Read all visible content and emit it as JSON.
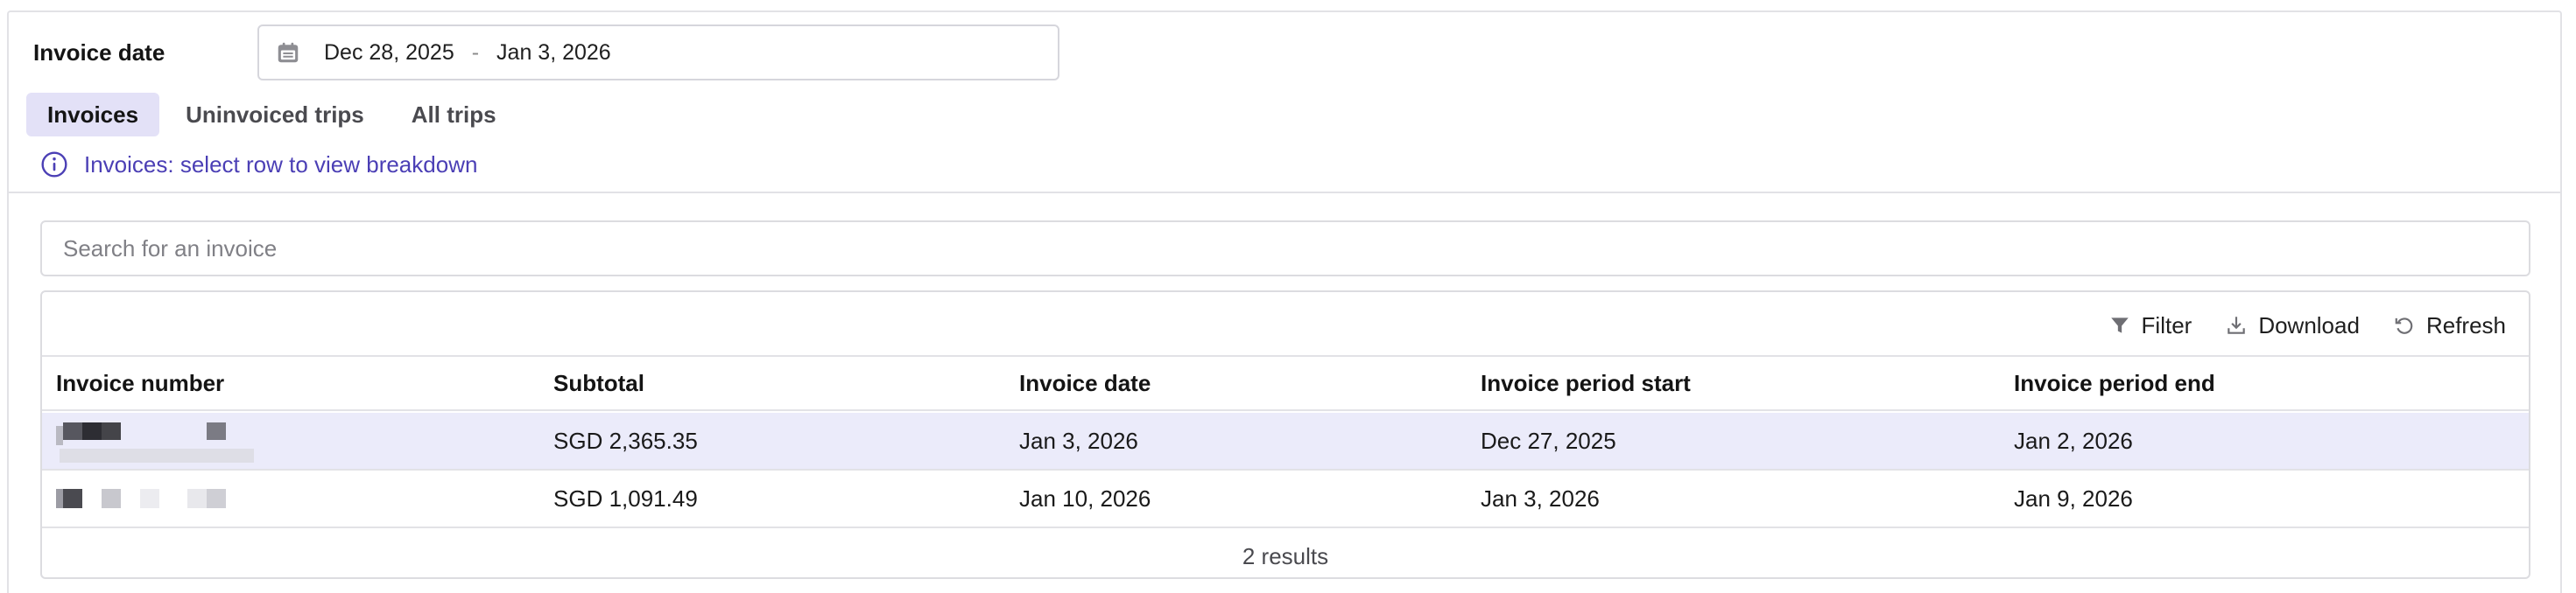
{
  "date_filter": {
    "label": "Invoice date",
    "start": "Dec 28, 2025",
    "separator": "-",
    "end": "Jan 3, 2026",
    "icon": "calendar-icon"
  },
  "tabs": [
    {
      "label": "Invoices",
      "active": true
    },
    {
      "label": "Uninvoiced trips",
      "active": false
    },
    {
      "label": "All trips",
      "active": false
    }
  ],
  "info": {
    "icon": "info-icon",
    "text": "Invoices: select row to view breakdown"
  },
  "search": {
    "placeholder": "Search for an invoice",
    "value": ""
  },
  "toolbar": {
    "filter_label": "Filter",
    "download_label": "Download",
    "refresh_label": "Refresh"
  },
  "table": {
    "columns": [
      "Invoice number",
      "Subtotal",
      "Invoice date",
      "Invoice period start",
      "Invoice period end"
    ],
    "rows": [
      {
        "invoice_number": "",
        "subtotal": "SGD 2,365.35",
        "invoice_date": "Jan 3, 2026",
        "period_start": "Dec 27, 2025",
        "period_end": "Jan 2, 2026",
        "selected": true
      },
      {
        "invoice_number": "",
        "subtotal": "SGD 1,091.49",
        "invoice_date": "Jan 10, 2026",
        "period_start": "Jan 3, 2026",
        "period_end": "Jan 9, 2026",
        "selected": false
      }
    ],
    "results_text": "2 results"
  },
  "colors": {
    "accent": "#4b3fb5",
    "tab_active_bg": "#e3e1f7",
    "row_selected_bg": "#ebebfa",
    "border": "#e2e2e6"
  }
}
